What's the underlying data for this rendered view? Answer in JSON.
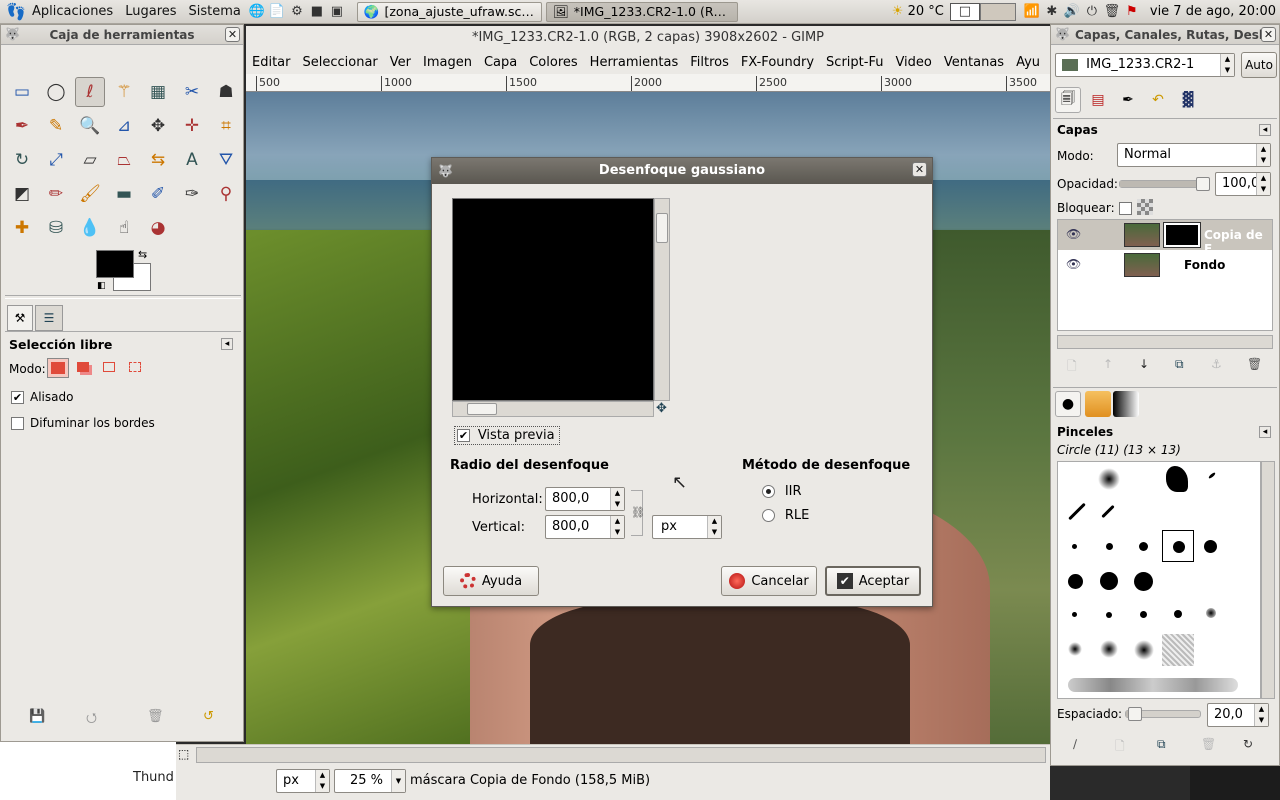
{
  "top_panel": {
    "menus": [
      "Aplicaciones",
      "Lugares",
      "Sistema"
    ],
    "tasks": [
      {
        "label": "[zona_ajuste_ufraw.sc…",
        "active": false
      },
      {
        "label": "*IMG_1233.CR2-1.0 (R…",
        "active": true
      }
    ],
    "weather": "20 °C",
    "clock": "vie  7 de ago, 20:00"
  },
  "image_window": {
    "title": "*IMG_1233.CR2-1.0 (RGB, 2 capas) 3908x2602 - GIMP",
    "menu": [
      "Editar",
      "Seleccionar",
      "Ver",
      "Imagen",
      "Capa",
      "Colores",
      "Herramientas",
      "Filtros",
      "FX-Foundry",
      "Script-Fu",
      "Video",
      "Ventanas",
      "Ayu"
    ],
    "ruler_ticks": [
      "500",
      "1000",
      "1500",
      "2000",
      "2500",
      "3000",
      "3500"
    ],
    "status": {
      "unit": "px",
      "zoom": "25 %",
      "message": "máscara Copia de Fondo (158,5 MiB)"
    }
  },
  "toolbox": {
    "title": "Caja de herramientas",
    "tool_icons": [
      "rect-select-icon",
      "ellipse-select-icon",
      "free-select-icon",
      "fuzzy-select-icon",
      "color-select-icon",
      "scissors-icon",
      "foreground-select-icon",
      "paths-icon",
      "color-picker-icon",
      "zoom-icon",
      "measure-icon",
      "move-icon",
      "align-icon",
      "crop-icon",
      "rotate-icon",
      "scale-icon",
      "shear-icon",
      "perspective-icon",
      "flip-icon",
      "text-icon",
      "bucket-fill-icon",
      "blend-icon",
      "pencil-icon",
      "paintbrush-icon",
      "eraser-icon",
      "airbrush-icon",
      "ink-icon",
      "clone-icon",
      "heal-icon",
      "perspective-clone-icon",
      "blur-icon",
      "smudge-icon",
      "dodge-icon"
    ],
    "tool_options": {
      "title": "Selección libre",
      "mode_label": "Modo:",
      "antialias_label": "Alisado",
      "antialias_checked": true,
      "feather_label": "Difuminar los bordes",
      "feather_checked": false
    }
  },
  "dock": {
    "title": "Capas, Canales, Rutas, Desh",
    "image_selector": "IMG_1233.CR2-1",
    "auto_label": "Auto",
    "layers": {
      "title": "Capas",
      "mode_label": "Modo:",
      "mode_value": "Normal",
      "opacity_label": "Opacidad:",
      "opacity_value": "100,0",
      "opacity_level": 1.0,
      "lock_label": "Bloquear:",
      "items": [
        {
          "name": "Copia de F",
          "selected": true
        },
        {
          "name": "Fondo",
          "selected": false
        }
      ]
    },
    "brushes": {
      "title": "Pinceles",
      "current": "Circle (11) (13 × 13)",
      "spacing_label": "Espaciado:",
      "spacing_value": "20,0",
      "spacing_level": 0.2
    }
  },
  "dialog": {
    "title": "Desenfoque gaussiano",
    "preview_label": "Vista previa",
    "preview_checked": true,
    "radius_title": "Radio del desenfoque",
    "horizontal_label": "Horizontal:",
    "horizontal_value": "800,0",
    "vertical_label": "Vertical:",
    "vertical_value": "800,0",
    "unit": "px",
    "method_title": "Método de desenfoque",
    "methods": [
      {
        "label": "IIR",
        "selected": true
      },
      {
        "label": "RLE",
        "selected": false
      }
    ],
    "help_label": "Ayuda",
    "cancel_label": "Cancelar",
    "ok_label": "Aceptar"
  },
  "background": {
    "bottom_text": "Thund"
  }
}
